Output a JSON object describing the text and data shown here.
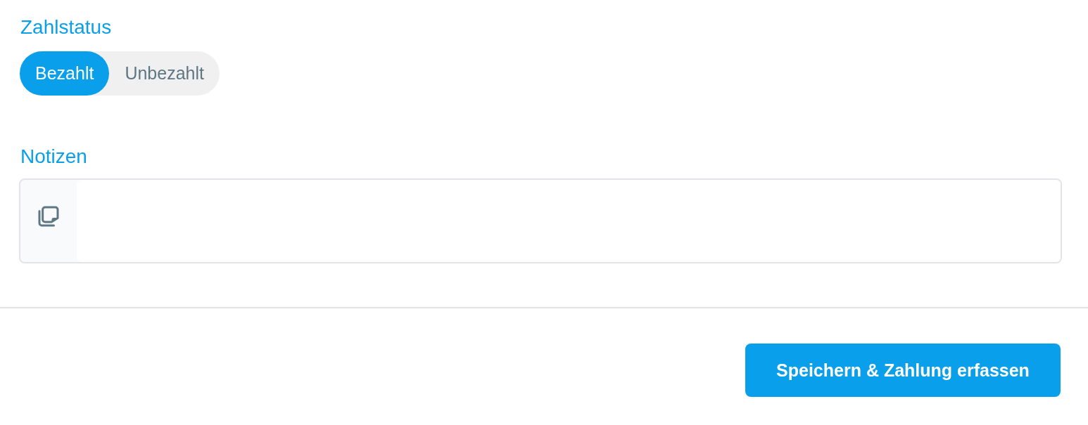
{
  "payment_status": {
    "label": "Zahlstatus",
    "options": [
      {
        "label": "Bezahlt",
        "selected": true
      },
      {
        "label": "Unbezahlt",
        "selected": false
      }
    ]
  },
  "notes": {
    "label": "Notizen"
  },
  "footer": {
    "submit_button": "Speichern & Zahlung erfassen"
  }
}
